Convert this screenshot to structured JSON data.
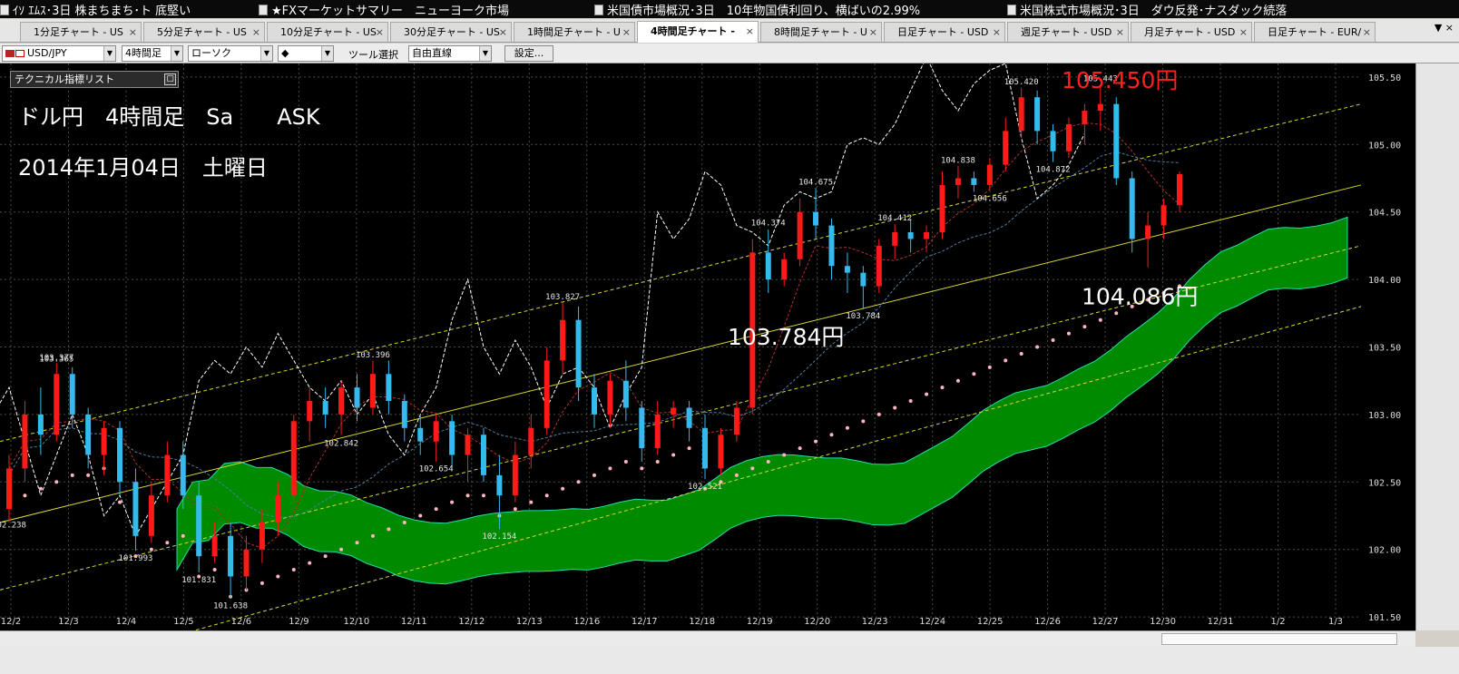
{
  "ticker": [
    "ｲｿ ｴﾑｽ･3日 株まちまち･ト 底堅い",
    "★FXマーケットサマリー　ニューヨーク市場",
    "米国債市場概況･3日　10年物国債利回り、横ばいの2.99%",
    "米国株式市場概況･3日　ダウ反発･ナスダック続落"
  ],
  "tabs": [
    {
      "label": "1分足チャート - US",
      "active": false
    },
    {
      "label": "5分足チャート - US",
      "active": false
    },
    {
      "label": "10分足チャート - US",
      "active": false
    },
    {
      "label": "30分足チャート - US",
      "active": false
    },
    {
      "label": "1時間足チャート - U",
      "active": false
    },
    {
      "label": "4時間足チャート -",
      "active": true
    },
    {
      "label": "8時間足チャート - U",
      "active": false
    },
    {
      "label": "日足チャート - USD",
      "active": false
    },
    {
      "label": "週足チャート - USD",
      "active": false
    },
    {
      "label": "月足チャート - USD",
      "active": false
    },
    {
      "label": "日足チャート - EUR/",
      "active": false
    }
  ],
  "tab_close": "×",
  "tab_nav": "▼ ×",
  "toolbar": {
    "pair": "USD/JPY",
    "timeframe": "4時間足",
    "chart_type": "ローソク",
    "marker": "◆",
    "tool_label": "ツール選択",
    "tool_value": "自由直線",
    "settings": "設定..."
  },
  "indicator_panel": {
    "label": "テクニカル指標リスト"
  },
  "colors": {
    "background": "#000000",
    "grid": "#4a4a3a",
    "bull": "#ff1a1a",
    "bear": "#33bbee",
    "cloud": "#008a00",
    "cloud_edge": "#22ddaa",
    "channel": "#d8d830",
    "parabolic": "#ffb6c1",
    "chikou": "#ffffff",
    "tenkan": "#b03030",
    "kijun": "#4c7fa0",
    "annotation": "#ffffff",
    "annotation_red": "#ff2020"
  },
  "chart_data": {
    "type": "candlestick",
    "instrument": "USD/JPY",
    "timeframe": "4時間足",
    "title_lines": [
      "ドル円　4時間足　Sa　　ASK",
      "2014年1月04日　土曜日"
    ],
    "ylim": [
      101.4,
      105.6
    ],
    "y_ticks": [
      "101.50",
      "102.00",
      "102.50",
      "103.00",
      "103.50",
      "104.00",
      "104.50",
      "105.00",
      "105.50"
    ],
    "x_labels": [
      "12/2",
      "12/3",
      "12/4",
      "12/5",
      "12/6",
      "12/9",
      "12/10",
      "12/11",
      "12/12",
      "12/13",
      "12/16",
      "12/17",
      "12/18",
      "12/19",
      "12/20",
      "12/23",
      "12/24",
      "12/25",
      "12/26",
      "12/27",
      "12/30",
      "12/31",
      "1/2",
      "1/3"
    ],
    "price_labels": [
      "103.377",
      "102.842",
      "101.993",
      "101.831",
      "101.638",
      "103.396",
      "102.154",
      "103.827",
      "102.654",
      "102.521",
      "104.374",
      "104.675",
      "103.365",
      "103.784",
      "104.412",
      "104.838",
      "104.656",
      "105.420",
      "104.872",
      "105.443",
      "102.238"
    ],
    "annotations": [
      {
        "text": "105.450円",
        "color": "red"
      },
      {
        "text": "103.784円",
        "color": "white"
      },
      {
        "text": "104.086円",
        "color": "white"
      }
    ],
    "candles_ohlc_approx": [
      [
        102.3,
        102.7,
        102.2,
        102.6
      ],
      [
        102.6,
        103.1,
        102.5,
        103.0
      ],
      [
        103.0,
        103.2,
        102.7,
        102.85
      ],
      [
        102.85,
        103.38,
        102.8,
        103.3
      ],
      [
        103.3,
        103.35,
        102.9,
        103.0
      ],
      [
        103.0,
        103.05,
        102.6,
        102.7
      ],
      [
        102.7,
        102.95,
        102.55,
        102.9
      ],
      [
        102.9,
        102.95,
        102.4,
        102.5
      ],
      [
        102.5,
        102.6,
        101.99,
        102.1
      ],
      [
        102.1,
        102.5,
        102.05,
        102.4
      ],
      [
        102.4,
        102.8,
        102.35,
        102.7
      ],
      [
        102.7,
        102.8,
        102.3,
        102.4
      ],
      [
        102.4,
        102.5,
        101.83,
        101.95
      ],
      [
        101.95,
        102.2,
        101.9,
        102.1
      ],
      [
        102.1,
        102.2,
        101.64,
        101.8
      ],
      [
        101.8,
        102.1,
        101.7,
        102.0
      ],
      [
        102.0,
        102.3,
        101.9,
        102.2
      ],
      [
        102.2,
        102.5,
        102.1,
        102.4
      ],
      [
        102.4,
        103.0,
        102.35,
        102.95
      ],
      [
        102.95,
        103.2,
        102.8,
        103.1
      ],
      [
        103.1,
        103.2,
        102.9,
        103.0
      ],
      [
        103.0,
        103.25,
        102.85,
        103.2
      ],
      [
        103.2,
        103.3,
        102.95,
        103.05
      ],
      [
        103.05,
        103.4,
        103.0,
        103.3
      ],
      [
        103.3,
        103.4,
        103.0,
        103.1
      ],
      [
        103.1,
        103.15,
        102.8,
        102.9
      ],
      [
        102.9,
        103.0,
        102.7,
        102.8
      ],
      [
        102.8,
        103.0,
        102.65,
        102.95
      ],
      [
        102.95,
        103.0,
        102.6,
        102.7
      ],
      [
        102.7,
        102.9,
        102.5,
        102.85
      ],
      [
        102.85,
        102.9,
        102.5,
        102.55
      ],
      [
        102.55,
        102.7,
        102.15,
        102.4
      ],
      [
        102.4,
        102.8,
        102.35,
        102.7
      ],
      [
        102.7,
        103.0,
        102.6,
        102.9
      ],
      [
        102.9,
        103.5,
        102.85,
        103.4
      ],
      [
        103.4,
        103.83,
        103.3,
        103.7
      ],
      [
        103.7,
        103.8,
        103.1,
        103.2
      ],
      [
        103.2,
        103.3,
        102.9,
        103.0
      ],
      [
        103.0,
        103.3,
        102.9,
        103.25
      ],
      [
        103.25,
        103.4,
        102.95,
        103.05
      ],
      [
        103.05,
        103.1,
        102.65,
        102.75
      ],
      [
        102.75,
        103.1,
        102.7,
        103.0
      ],
      [
        103.0,
        103.1,
        102.9,
        103.05
      ],
      [
        103.05,
        103.1,
        102.8,
        102.9
      ],
      [
        102.9,
        103.0,
        102.52,
        102.6
      ],
      [
        102.6,
        102.9,
        102.55,
        102.85
      ],
      [
        102.85,
        103.1,
        102.8,
        103.05
      ],
      [
        103.05,
        104.3,
        103.0,
        104.2
      ],
      [
        104.2,
        104.37,
        103.9,
        104.0
      ],
      [
        104.0,
        104.2,
        103.95,
        104.15
      ],
      [
        104.15,
        104.6,
        104.1,
        104.5
      ],
      [
        104.5,
        104.68,
        104.3,
        104.4
      ],
      [
        104.4,
        104.45,
        104.0,
        104.1
      ],
      [
        104.1,
        104.2,
        103.9,
        104.05
      ],
      [
        104.05,
        104.1,
        103.78,
        103.95
      ],
      [
        103.95,
        104.3,
        103.9,
        104.25
      ],
      [
        104.25,
        104.41,
        104.15,
        104.35
      ],
      [
        104.35,
        104.45,
        104.2,
        104.3
      ],
      [
        104.3,
        104.4,
        104.2,
        104.35
      ],
      [
        104.35,
        104.8,
        104.3,
        104.7
      ],
      [
        104.7,
        104.84,
        104.6,
        104.75
      ],
      [
        104.75,
        104.8,
        104.65,
        104.7
      ],
      [
        104.7,
        104.9,
        104.66,
        104.85
      ],
      [
        104.85,
        105.2,
        104.8,
        105.1
      ],
      [
        105.1,
        105.42,
        105.05,
        105.35
      ],
      [
        105.35,
        105.4,
        105.0,
        105.1
      ],
      [
        105.1,
        105.15,
        104.87,
        104.95
      ],
      [
        104.95,
        105.2,
        104.9,
        105.15
      ],
      [
        105.15,
        105.3,
        105.0,
        105.25
      ],
      [
        105.25,
        105.44,
        105.1,
        105.3
      ],
      [
        105.3,
        105.35,
        104.7,
        104.75
      ],
      [
        104.75,
        104.8,
        104.2,
        104.3
      ],
      [
        104.3,
        104.5,
        104.09,
        104.4
      ],
      [
        104.4,
        104.6,
        104.3,
        104.55
      ],
      [
        104.55,
        104.8,
        104.5,
        104.78
      ]
    ],
    "grid": true
  }
}
